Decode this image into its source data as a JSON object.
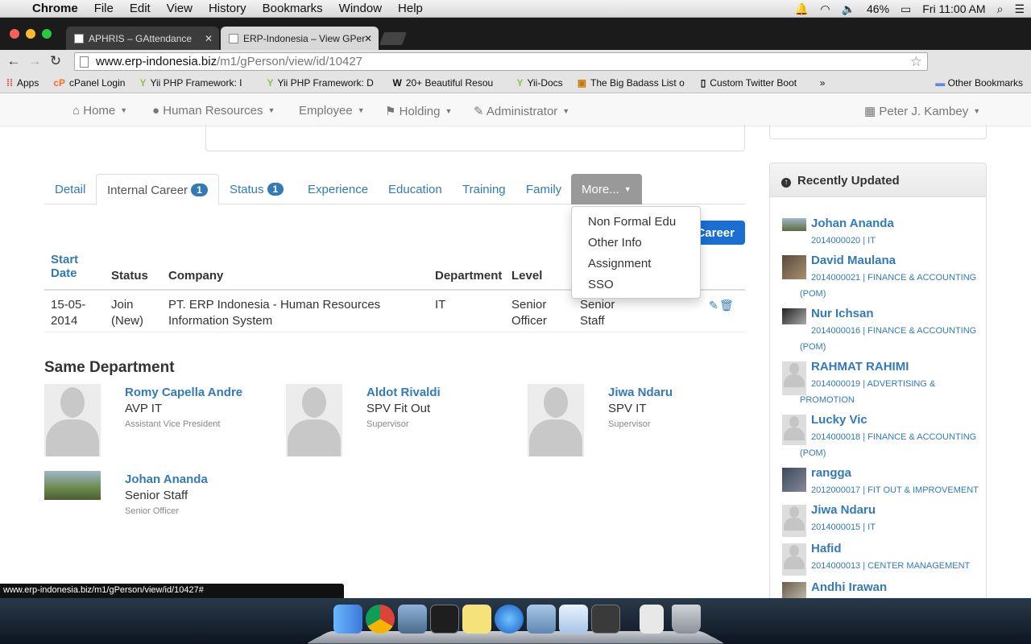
{
  "macbar": {
    "app": "Chrome",
    "menus": [
      "File",
      "Edit",
      "View",
      "History",
      "Bookmarks",
      "Window",
      "Help"
    ],
    "battery": "46%",
    "clock": "Fri 11:00 AM"
  },
  "browser": {
    "tabs": [
      {
        "title": "APHRIS – GAttendance"
      },
      {
        "title": "ERP-Indonesia – View GPer"
      }
    ],
    "url_host": "www.erp-indonesia.biz",
    "url_path": "/m1/gPerson/view/id/10427",
    "bookmarks": [
      "Apps",
      "cPanel Login",
      "Yii PHP Framework: I",
      "Yii PHP Framework: D",
      "20+ Beautiful Resou",
      "Yii-Docs",
      "The Big Badass List o",
      "Custom Twitter Boot"
    ],
    "bookmarks_overflow": "»",
    "other_bookmarks": "Other Bookmarks",
    "status_url": "www.erp-indonesia.biz/m1/gPerson/view/id/10427#"
  },
  "nav": {
    "items": [
      "Home",
      "Human Resources",
      "Employee",
      "Holding",
      "Administrator"
    ],
    "user": "Peter J. Kambey"
  },
  "tabs": [
    {
      "label": "Detail"
    },
    {
      "label": "Internal Career",
      "badge": "1"
    },
    {
      "label": "Status",
      "badge": "1"
    },
    {
      "label": "Experience"
    },
    {
      "label": "Education"
    },
    {
      "label": "Training"
    },
    {
      "label": "Family"
    },
    {
      "label": "More..."
    }
  ],
  "more_menu": [
    "Non Formal Edu",
    "Other Info",
    "Assignment",
    "SSO"
  ],
  "add_button": "Career",
  "career_table": {
    "headers": {
      "start_date_1": "Start",
      "start_date_2": "Date",
      "status": "Status",
      "company": "Company",
      "department": "Department",
      "level": "Level"
    },
    "row": {
      "start_date_1": "15-05-",
      "start_date_2": "2014",
      "status_1": "Join",
      "status_2": "(New)",
      "company_1": "PT. ERP Indonesia - Human Resources",
      "company_2": "Information System",
      "department": "IT",
      "level_1": "Senior",
      "level_2": "Officer",
      "position_1": "Senior",
      "position_2": "Staff"
    }
  },
  "same_department": {
    "title": "Same Department",
    "people": [
      {
        "name": "Romy Capella Andre",
        "position": "AVP IT",
        "level": "Assistant Vice President"
      },
      {
        "name": "Aldot Rivaldi",
        "position": "SPV Fit Out",
        "level": "Supervisor"
      },
      {
        "name": "Jiwa Ndaru",
        "position": "SPV IT",
        "level": "Supervisor"
      },
      {
        "name": "Johan Ananda",
        "position": "Senior Staff",
        "level": "Senior Officer"
      }
    ]
  },
  "recently_updated": {
    "title": "Recently Updated",
    "items": [
      {
        "name": "Johan Ananda",
        "meta": "2014000020 | IT"
      },
      {
        "name": "David Maulana",
        "meta": "2014000021 | FINANCE & ACCOUNTING (POM)"
      },
      {
        "name": "Nur Ichsan",
        "meta": "2014000016 | FINANCE & ACCOUNTING (POM)"
      },
      {
        "name": "RAHMAT RAHIMI",
        "meta": "2014000019 | ADVERTISING & PROMOTION"
      },
      {
        "name": "Lucky Vic",
        "meta": "2014000018 | FINANCE & ACCOUNTING (POM)"
      },
      {
        "name": "rangga",
        "meta": "2012000017 | FIT OUT & IMPROVEMENT"
      },
      {
        "name": "Jiwa Ndaru",
        "meta": "2014000015 | IT"
      },
      {
        "name": "Hafid",
        "meta": "2014000013 | CENTER MANAGEMENT"
      },
      {
        "name": "Andhi Irawan",
        "meta": ""
      }
    ]
  }
}
